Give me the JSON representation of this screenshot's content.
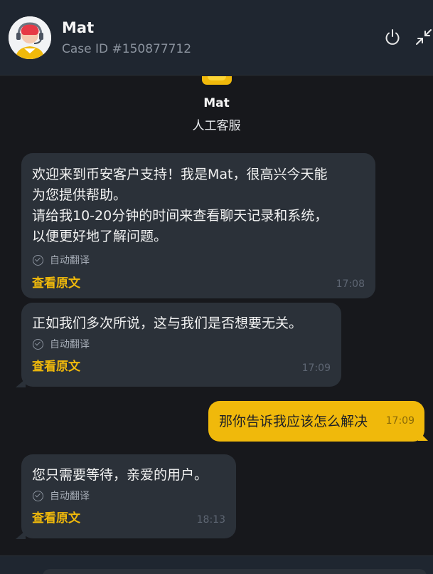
{
  "header": {
    "agent_name": "Mat",
    "case_id": "Case ID #150877712"
  },
  "icons": {
    "avatar": "support-agent-avatar",
    "power": "power-icon",
    "minimize": "minimize-icon",
    "check": "check-circle-icon"
  },
  "colors": {
    "accent": "#f0b90b",
    "background": "#17181c",
    "header_bg": "#1f2630",
    "bubble_bg": "#2b3139"
  },
  "agent_card": {
    "name": "Mat",
    "role": "人工客服"
  },
  "messages": [
    {
      "sender": "agent",
      "lines": [
        "欢迎来到币安客户支持！我是Mat，很高兴今天能",
        "为您提供帮助。",
        "请给我10-20分钟的时间来查看聊天记录和系统，",
        "以便更好地了解问题。"
      ],
      "auto_translate_label": "自动翻译",
      "view_original_label": "查看原文",
      "time": "17:08"
    },
    {
      "sender": "agent",
      "lines": [
        "正如我们多次所说，这与我们是否想要无关。"
      ],
      "auto_translate_label": "自动翻译",
      "view_original_label": "查看原文",
      "time": "17:09"
    },
    {
      "sender": "user",
      "text": "那你告诉我应该怎么解决",
      "time": "17:09"
    },
    {
      "sender": "agent",
      "lines": [
        "您只需要等待，亲爱的用户。"
      ],
      "auto_translate_label": "自动翻译",
      "view_original_label": "查看原文",
      "time": "18:13"
    }
  ]
}
